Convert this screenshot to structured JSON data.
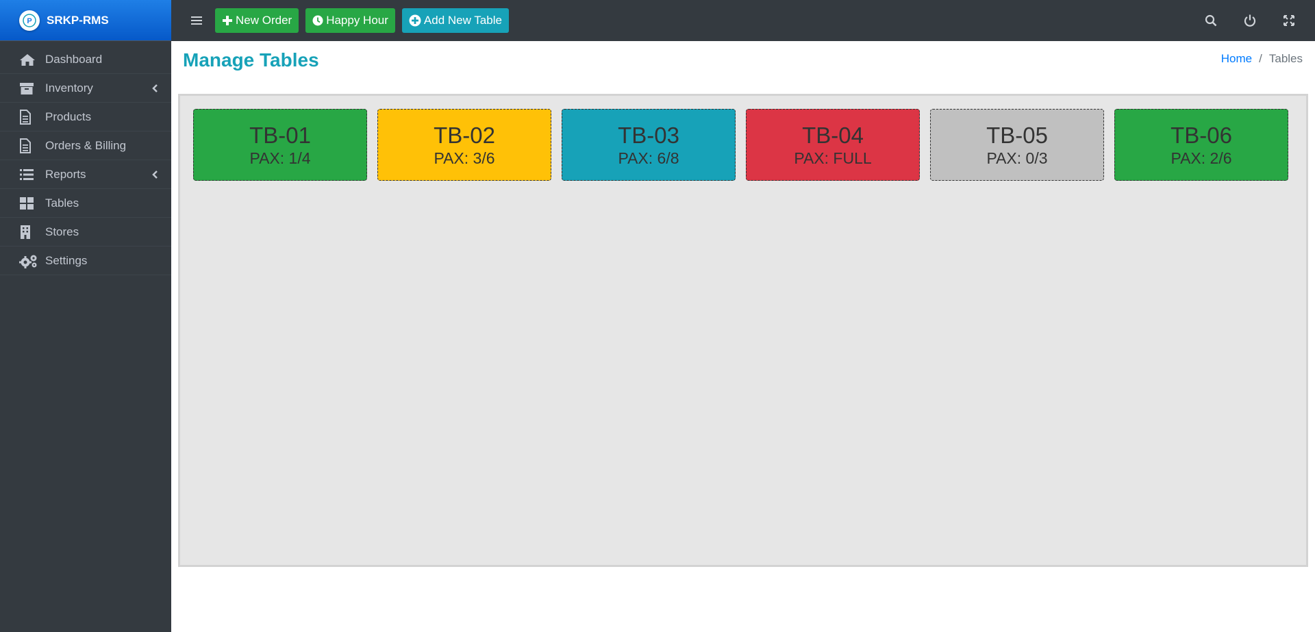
{
  "app": {
    "brand": "SRKP-RMS"
  },
  "sidebar": {
    "items": [
      {
        "label": "Dashboard",
        "icon": "home-icon",
        "has_caret": false
      },
      {
        "label": "Inventory",
        "icon": "archive-icon",
        "has_caret": true
      },
      {
        "label": "Products",
        "icon": "file-icon",
        "has_caret": false
      },
      {
        "label": "Orders & Billing",
        "icon": "file-icon",
        "has_caret": false
      },
      {
        "label": "Reports",
        "icon": "list-icon",
        "has_caret": true
      },
      {
        "label": "Tables",
        "icon": "grid-icon",
        "has_caret": false
      },
      {
        "label": "Stores",
        "icon": "building-icon",
        "has_caret": false
      },
      {
        "label": "Settings",
        "icon": "gears-icon",
        "has_caret": false
      }
    ]
  },
  "toolbar": {
    "new_order": "New Order",
    "happy_hour": "Happy Hour",
    "add_table": "Add New Table"
  },
  "page": {
    "title": "Manage Tables",
    "breadcrumb": {
      "home": "Home",
      "separator": "/",
      "current": "Tables"
    }
  },
  "tables": [
    {
      "name": "TB-01",
      "pax": "PAX: 1/4",
      "color": "#28a745"
    },
    {
      "name": "TB-02",
      "pax": "PAX: 3/6",
      "color": "#ffc107"
    },
    {
      "name": "TB-03",
      "pax": "PAX: 6/8",
      "color": "#17a2b8"
    },
    {
      "name": "TB-04",
      "pax": "PAX: FULL",
      "color": "#dc3545"
    },
    {
      "name": "TB-05",
      "pax": "PAX: 0/3",
      "color": "#c0c0c0"
    },
    {
      "name": "TB-06",
      "pax": "PAX: 2/6",
      "color": "#28a745"
    }
  ],
  "colors": {
    "sidebar_bg": "#343a40",
    "brand_bg": "#0659c9",
    "accent": "#17a2b8",
    "success": "#28a745"
  }
}
